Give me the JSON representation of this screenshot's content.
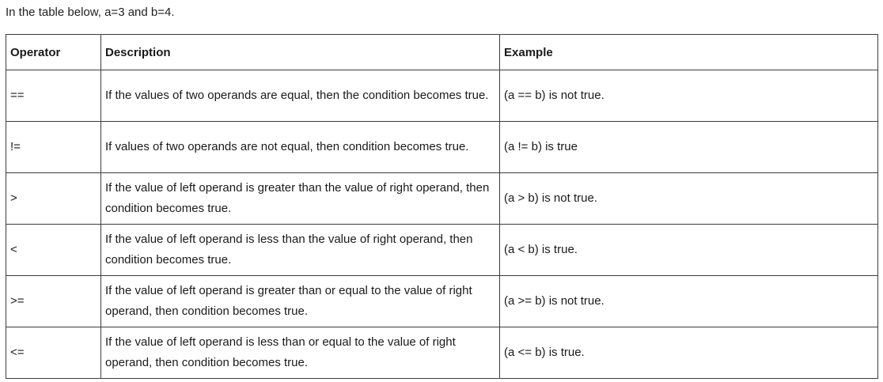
{
  "intro": "In the table below, a=3 and b=4.",
  "table": {
    "headers": {
      "operator": "Operator",
      "description": "Description",
      "example": "Example"
    },
    "rows": [
      {
        "operator": "==",
        "description": "If the values of two operands are equal, then the condition becomes true.",
        "example": "(a == b) is not true."
      },
      {
        "operator": "!=",
        "description": "If values of two operands are not equal, then condition becomes true.",
        "example": "(a != b) is true"
      },
      {
        "operator": ">",
        "description": "If the value of left operand is greater than the value of right operand, then condition becomes true.",
        "example": "(a > b) is not true."
      },
      {
        "operator": "<",
        "description": "If the value of left operand is less than the value of right operand, then condition becomes true.",
        "example": "(a < b) is true."
      },
      {
        "operator": ">=",
        "description": "If the value of left operand is greater than or equal to the value of right operand, then condition becomes true.",
        "example": "(a >= b) is not true."
      },
      {
        "operator": "<=",
        "description": "If the value of left operand is less than or equal to the value of right operand, then condition becomes true.",
        "example": "(a <= b) is true."
      }
    ]
  }
}
